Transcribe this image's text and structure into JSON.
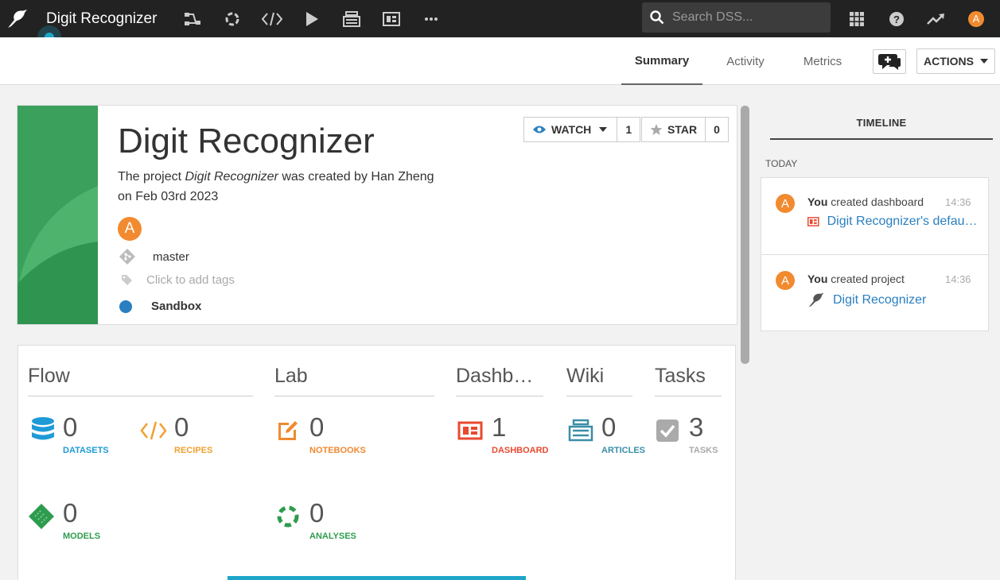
{
  "topbar": {
    "project_title": "Digit Recognizer",
    "search_placeholder": "Search DSS...",
    "user_initial": "A",
    "nav_icons": [
      "flow-icon",
      "analysis-icon",
      "code-icon",
      "run-icon",
      "wiki-icon",
      "dashboard-icon",
      "more-icon"
    ],
    "right_icons": [
      "apps-grid-icon",
      "help-icon",
      "trend-icon"
    ]
  },
  "subheader": {
    "tabs": [
      {
        "label": "Summary",
        "active": true
      },
      {
        "label": "Activity",
        "active": false
      },
      {
        "label": "Metrics",
        "active": false
      }
    ],
    "actions_label": "ACTIONS"
  },
  "project": {
    "title": "Digit Recognizer",
    "desc_prefix": "The project",
    "desc_name": "Digit Recognizer",
    "desc_suffix": "was created by Han Zheng",
    "desc_date": "on Feb 03rd 2023",
    "owner_initial": "A",
    "branch": "master",
    "tags_placeholder": "Click to add tags",
    "status": "Sandbox",
    "watch_label": "WATCH",
    "watch_count": "1",
    "star_label": "STAR",
    "star_count": "0",
    "band_color": "#3aa05c"
  },
  "sections": {
    "flow": "Flow",
    "lab": "Lab",
    "dashboards": "Dashboards",
    "wiki": "Wiki",
    "tasks": "Tasks"
  },
  "stats": {
    "datasets": {
      "count": "0",
      "label": "DATASETS",
      "color": "#1e9bd7"
    },
    "recipes": {
      "count": "0",
      "label": "RECIPES",
      "color": "#f0a030"
    },
    "notebooks": {
      "count": "0",
      "label": "NOTEBOOKS",
      "color": "#f08a30"
    },
    "dashboard": {
      "count": "1",
      "label": "DASHBOARD",
      "color": "#e8492f"
    },
    "articles": {
      "count": "0",
      "label": "ARTICLES",
      "color": "#3a8ea8"
    },
    "tasks": {
      "count": "3",
      "label": "TASKS",
      "color": "#aaaaaa"
    },
    "models": {
      "count": "0",
      "label": "MODELS",
      "color": "#2e9c4e"
    },
    "analyses": {
      "count": "0",
      "label": "ANALYSES",
      "color": "#2e9c4e"
    }
  },
  "timeline": {
    "title": "TIMELINE",
    "today_label": "TODAY",
    "items": [
      {
        "initial": "A",
        "actor": "You",
        "action": "created dashboard",
        "time": "14:36",
        "link": "Digit Recognizer's default dashboard",
        "icon": "dashboard-icon"
      },
      {
        "initial": "A",
        "actor": "You",
        "action": "created project",
        "time": "14:36",
        "link": "Digit Recognizer",
        "icon": "bird-icon"
      }
    ]
  }
}
